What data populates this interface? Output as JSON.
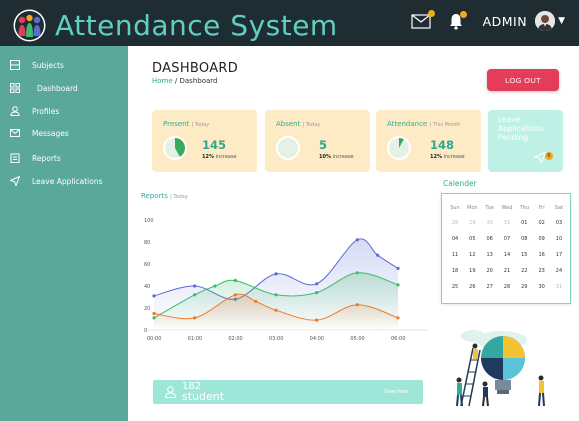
{
  "app": {
    "title": "Attendance System"
  },
  "header": {
    "user_label": "ADMIN",
    "icons": [
      "mail-icon",
      "bell-icon",
      "avatar",
      "caret-down-icon"
    ]
  },
  "sidebar": {
    "items": [
      {
        "label": "Subjects",
        "icon": "list-icon"
      },
      {
        "label": "Dashboard",
        "icon": "grid-icon"
      },
      {
        "label": "Profiles",
        "icon": "user-icon"
      },
      {
        "label": "Messages",
        "icon": "mail-icon"
      },
      {
        "label": "Reports",
        "icon": "clipboard-icon"
      },
      {
        "label": "Leave Applications",
        "icon": "send-icon"
      }
    ]
  },
  "page": {
    "title": "DASHBOARD",
    "breadcrumb_home": "Home",
    "breadcrumb_sep": "/",
    "breadcrumb_current": "Dashboard",
    "logout_label": "LOG OUT"
  },
  "cards": {
    "present": {
      "title": "Present",
      "sub": "| Today",
      "value": "145",
      "pct": "12%",
      "pct_label": "increase",
      "ring_fraction": 0.42
    },
    "absent": {
      "title": "Absent",
      "sub": "| Today",
      "value": "5",
      "pct": "10%",
      "pct_label": "increase",
      "ring_fraction": 0.0
    },
    "attendance": {
      "title": "Attendance",
      "sub": "| This Month",
      "value": "148",
      "pct": "12%",
      "pct_label": "increase",
      "ring_fraction": 0.08
    },
    "pending": {
      "title": "Leave Applications Pending",
      "count": "6"
    }
  },
  "reports": {
    "title": "Reports",
    "sub": "| Today"
  },
  "chart_data": {
    "type": "area",
    "x": [
      "00:00",
      "01:00",
      "02:00",
      "03:00",
      "04:00",
      "05:00",
      "06:00"
    ],
    "ylim": [
      0,
      100
    ],
    "yticks": [
      "100",
      "80",
      "60",
      "40",
      "20",
      "0"
    ],
    "grid": false,
    "series": [
      {
        "color": "#5b6cd6",
        "x": [
          0,
          1,
          2,
          3,
          4,
          5,
          5.5,
          6
        ],
        "values": [
          31,
          40,
          28,
          51,
          42,
          82,
          68,
          56
        ]
      },
      {
        "color": "#3dbb6a",
        "x": [
          0,
          1,
          1.5,
          2,
          3,
          4,
          5,
          6
        ],
        "values": [
          11,
          32,
          40,
          45,
          32,
          34,
          52,
          41
        ]
      },
      {
        "color": "#f07a2a",
        "x": [
          0,
          1,
          2,
          2.5,
          3,
          4,
          5,
          6
        ],
        "values": [
          15,
          11,
          32,
          26,
          18,
          9,
          23,
          11
        ]
      }
    ]
  },
  "calendar": {
    "title": "Calender",
    "weekdays": [
      "Sun",
      "Mon",
      "Tue",
      "Wed",
      "Thu",
      "Fri",
      "Sat"
    ],
    "weeks": [
      [
        "28",
        "29",
        "30",
        "31",
        "01",
        "02",
        "03"
      ],
      [
        "04",
        "05",
        "06",
        "07",
        "08",
        "09",
        "10"
      ],
      [
        "11",
        "12",
        "13",
        "14",
        "15",
        "16",
        "17"
      ],
      [
        "18",
        "19",
        "20",
        "21",
        "22",
        "23",
        "24"
      ],
      [
        "25",
        "26",
        "27",
        "28",
        "29",
        "30",
        "31"
      ]
    ]
  },
  "students": {
    "count": "182",
    "label": "student",
    "view_label": "View here"
  },
  "colors": {
    "topbar": "#1f2d33",
    "sidebar": "#5aa89a",
    "accent": "#29b19b",
    "logout": "#e43d5a",
    "card": "#fdebc6",
    "pending": "#bff0e6"
  }
}
